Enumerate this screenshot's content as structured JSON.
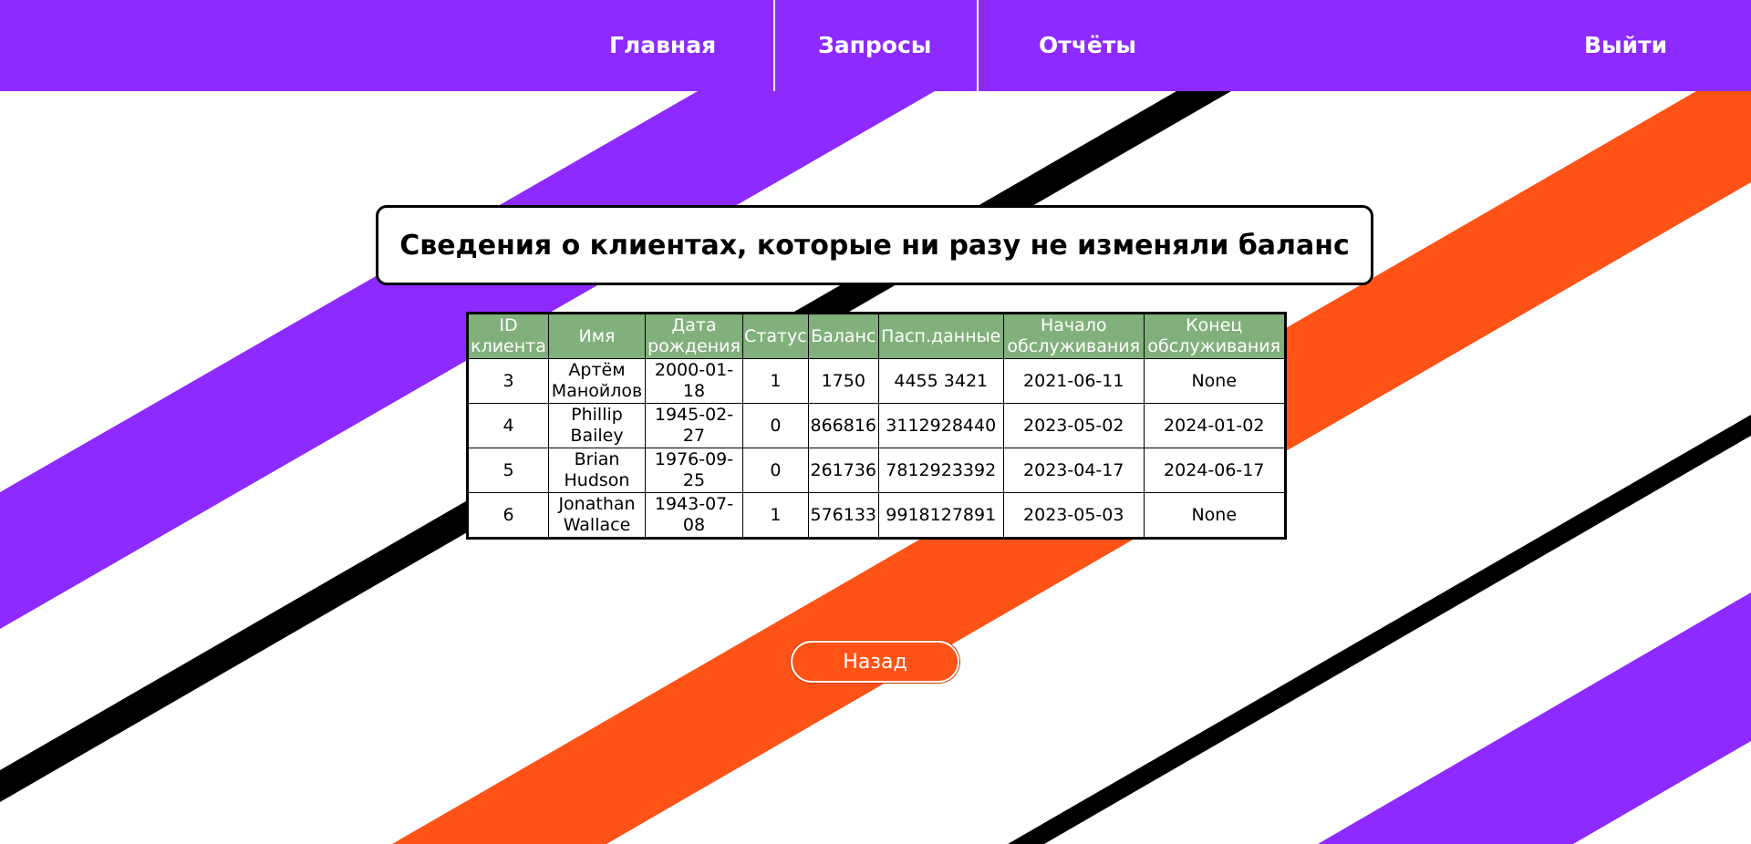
{
  "nav": {
    "home": "Главная",
    "requests": "Запросы",
    "reports": "Отчёты",
    "logout": "Выйти"
  },
  "page": {
    "title": "Сведения о клиентах, которые ни разу не изменяли баланс"
  },
  "table": {
    "headers": [
      "ID клиента",
      "Имя",
      "Дата рождения",
      "Статус",
      "Баланс",
      "Пасп.данные",
      "Начало обслуживания",
      "Конец обслуживания"
    ],
    "rows": [
      [
        "3",
        "Артём Манойлов",
        "2000-01-18",
        "1",
        "1750",
        "4455 3421",
        "2021-06-11",
        "None"
      ],
      [
        "4",
        "Phillip Bailey",
        "1945-02-27",
        "0",
        "866816",
        "3112928440",
        "2023-05-02",
        "2024-01-02"
      ],
      [
        "5",
        "Brian Hudson",
        "1976-09-25",
        "0",
        "261736",
        "7812923392",
        "2023-04-17",
        "2024-06-17"
      ],
      [
        "6",
        "Jonathan Wallace",
        "1943-07-08",
        "1",
        "576133",
        "9918127891",
        "2023-05-03",
        "None"
      ]
    ]
  },
  "actions": {
    "back": "Назад"
  },
  "colors": {
    "nav_bg": "#8c2aff",
    "stripe_purple": "#8c2aff",
    "stripe_orange": "#ff5216",
    "stripe_black": "#000000",
    "table_header": "#82b07c",
    "button_bg": "#ff5216"
  }
}
